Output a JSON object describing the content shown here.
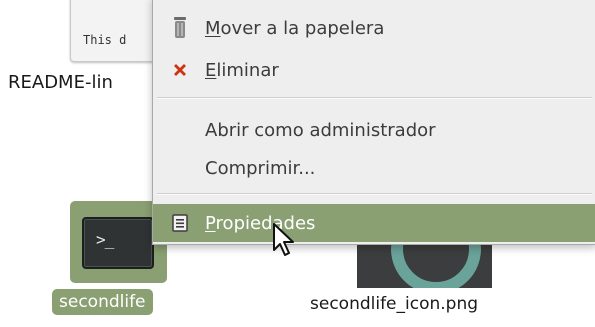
{
  "desktop": {
    "readme": {
      "thumb_text": "This d",
      "label": "README-lin"
    },
    "secondlife": {
      "terminal_prompt": ">_",
      "label": "secondlife"
    },
    "secondlife_icon": {
      "label": "secondlife_icon.png"
    }
  },
  "context_menu": {
    "trash": {
      "accel": "M",
      "rest": "over a la papelera",
      "icon": "trash-icon"
    },
    "delete": {
      "accel": "E",
      "rest": "liminar",
      "icon": "red-x-icon"
    },
    "open_admin": {
      "label": "Abrir como administrador"
    },
    "compress": {
      "label": "Comprimir..."
    },
    "properties": {
      "accel": "P",
      "rest": "ropiedades",
      "icon": "properties-icon",
      "highlighted": true
    }
  },
  "colors": {
    "selection": "#8aa072",
    "menu_bg": "#eeeeee",
    "delete_icon": "#cc3311"
  }
}
